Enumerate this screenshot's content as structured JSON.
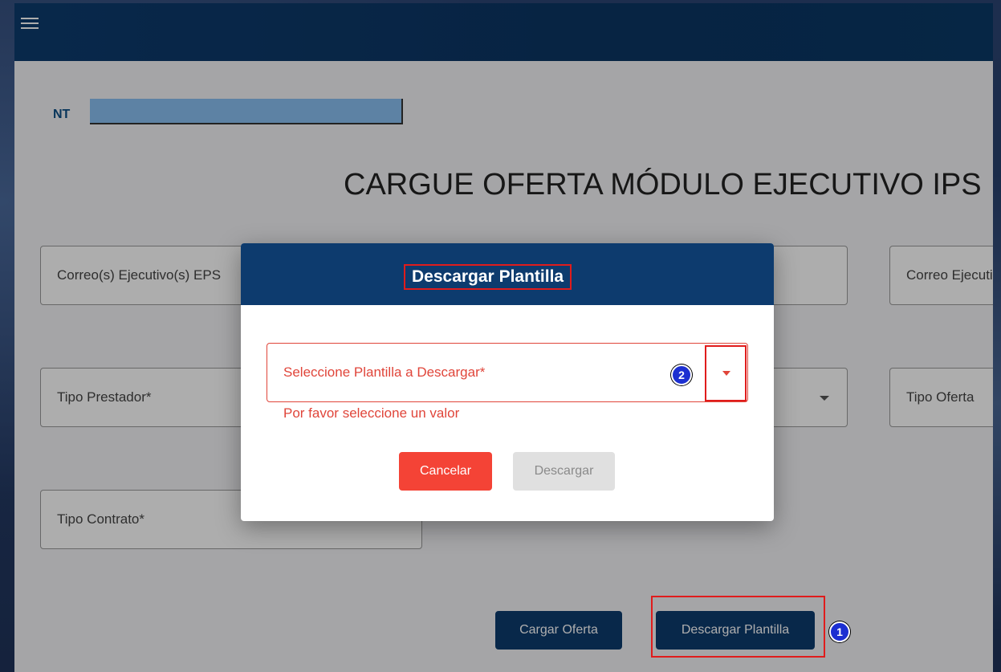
{
  "app": {
    "nt_label": "NT",
    "page_title": "CARGUE OFERTA MÓDULO EJECUTIVO IPS"
  },
  "form": {
    "correo_ejecutivo_eps": "Correo(s) Ejecutivo(s) EPS",
    "correo_ejecutivo_ips": "Correo Ejecutivo IPS",
    "tipo_prestador": "Tipo Prestador*",
    "tipo_oferta": "Tipo Oferta",
    "tipo_contrato": "Tipo Contrato*"
  },
  "actions": {
    "cargar_oferta": "Cargar Oferta",
    "descargar_plantilla": "Descargar Plantilla"
  },
  "dialog": {
    "title": "Descargar Plantilla",
    "select_placeholder": "Seleccione Plantilla a Descargar*",
    "error": "Por favor seleccione un valor",
    "cancel_label": "Cancelar",
    "download_label": "Descargar"
  },
  "markers": {
    "one": "1",
    "two": "2"
  },
  "colors": {
    "primary": "#0d3b6e",
    "error": "#e0453a",
    "cancel": "#f44336",
    "highlight": "#e01c1c",
    "marker": "#1c2fd1"
  }
}
